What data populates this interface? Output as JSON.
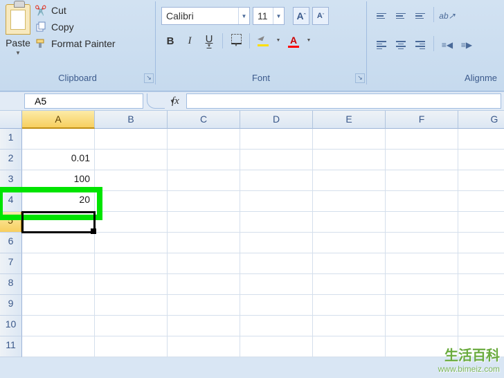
{
  "ribbon": {
    "clipboard": {
      "paste": "Paste",
      "cut": "Cut",
      "copy": "Copy",
      "format_painter": "Format Painter",
      "label": "Clipboard"
    },
    "font": {
      "family": "Calibri",
      "size": "11",
      "label": "Font"
    },
    "alignment": {
      "label": "Alignme"
    }
  },
  "namebox": {
    "cell_ref": "A5",
    "fx": "fx"
  },
  "columns": [
    "A",
    "B",
    "C",
    "D",
    "E",
    "F",
    "G"
  ],
  "rows": [
    "1",
    "2",
    "3",
    "4",
    "5",
    "6",
    "7",
    "8",
    "9",
    "10",
    "11"
  ],
  "cells": {
    "A2": "0.01",
    "A3": "100",
    "A4": "20"
  },
  "selected": {
    "col": "A",
    "row": "5"
  },
  "highlight": {
    "row": "4"
  },
  "watermark": {
    "cn": "生活百科",
    "url": "www.bimeiz.com"
  }
}
